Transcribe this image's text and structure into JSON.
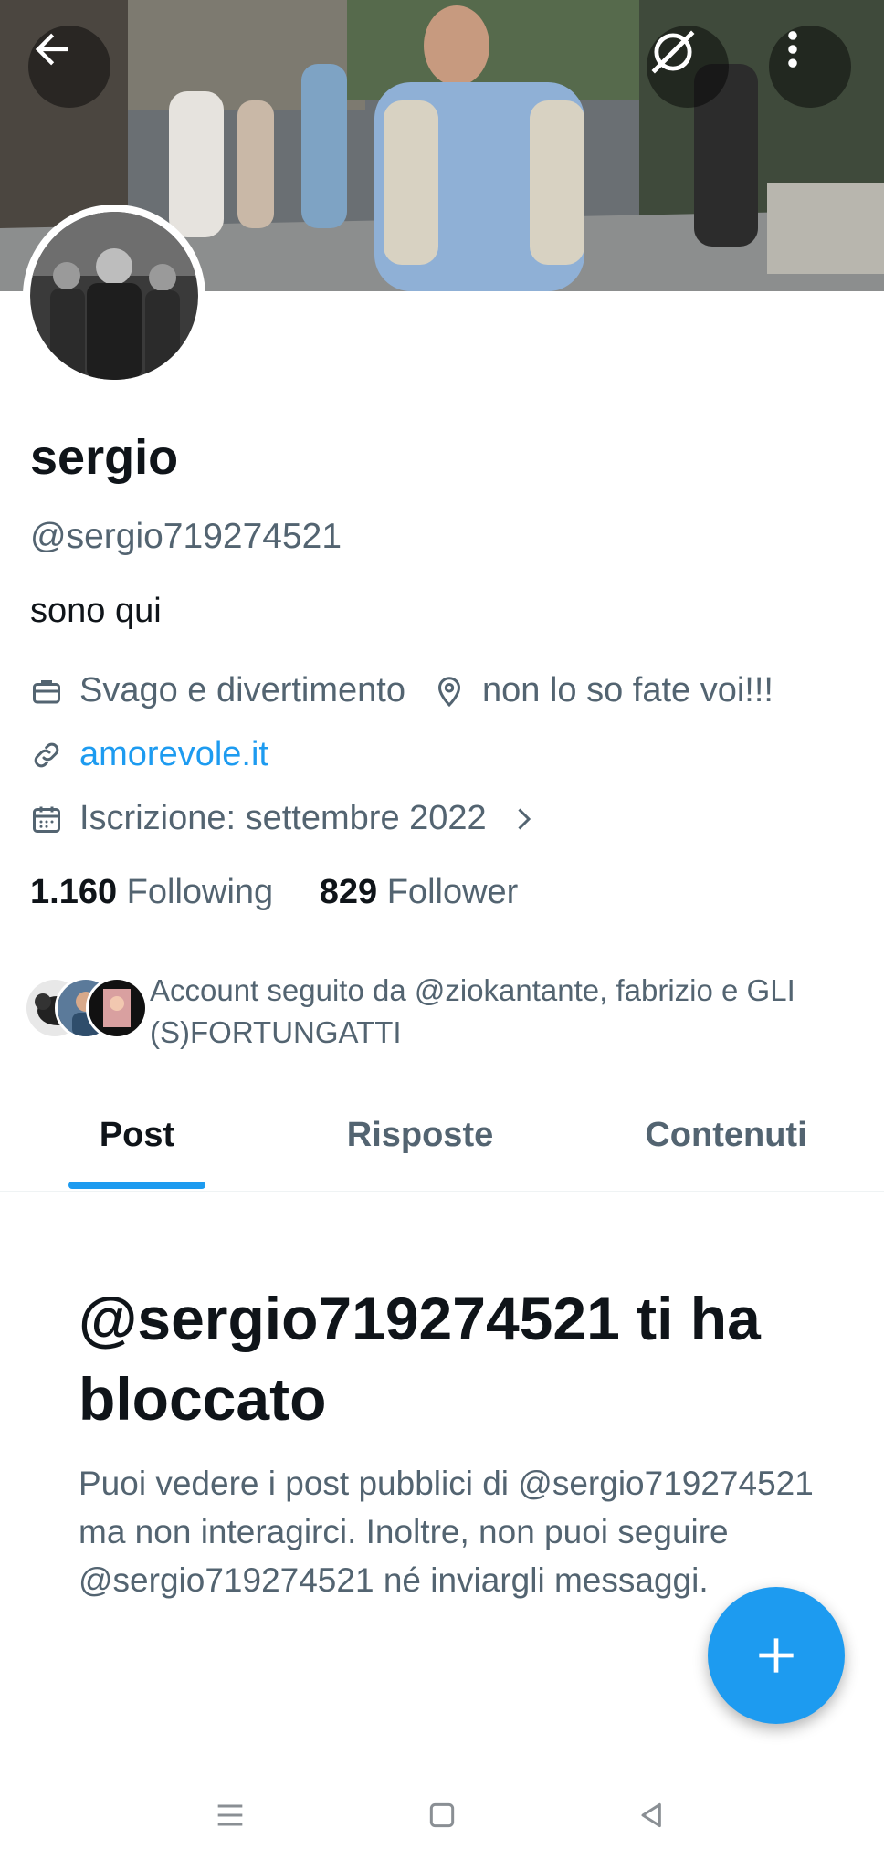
{
  "header": {
    "back_icon": "arrow-left-icon",
    "grok_icon": "slashed-circle-icon",
    "more_icon": "more-vertical-icon"
  },
  "profile": {
    "display_name": "sergio",
    "handle": "@sergio719274521",
    "bio": "sono qui",
    "category": "Svago e divertimento",
    "location": "non lo so fate voi!!!",
    "website": "amorevole.it",
    "joined": "Iscrizione: settembre 2022",
    "following_count": "1.160",
    "following_label": "Following",
    "followers_count": "829",
    "followers_label": "Follower",
    "followed_by": "Account seguito da @ziokantante, fabrizio e GLI (S)FORTUNGATTI"
  },
  "tabs": [
    {
      "label": "Post",
      "active": true
    },
    {
      "label": "Risposte",
      "active": false
    },
    {
      "label": "Contenuti",
      "active": false
    }
  ],
  "blocked": {
    "title": "@sergio719274521 ti ha bloccato",
    "body": "Puoi vedere i post pubblici di @sergio719274521 ma non interagirci. Inoltre, non puoi seguire @sergio719274521 né inviargli messaggi."
  },
  "colors": {
    "accent": "#1d9bf0",
    "text_primary": "#0f1419",
    "text_secondary": "#536471"
  }
}
